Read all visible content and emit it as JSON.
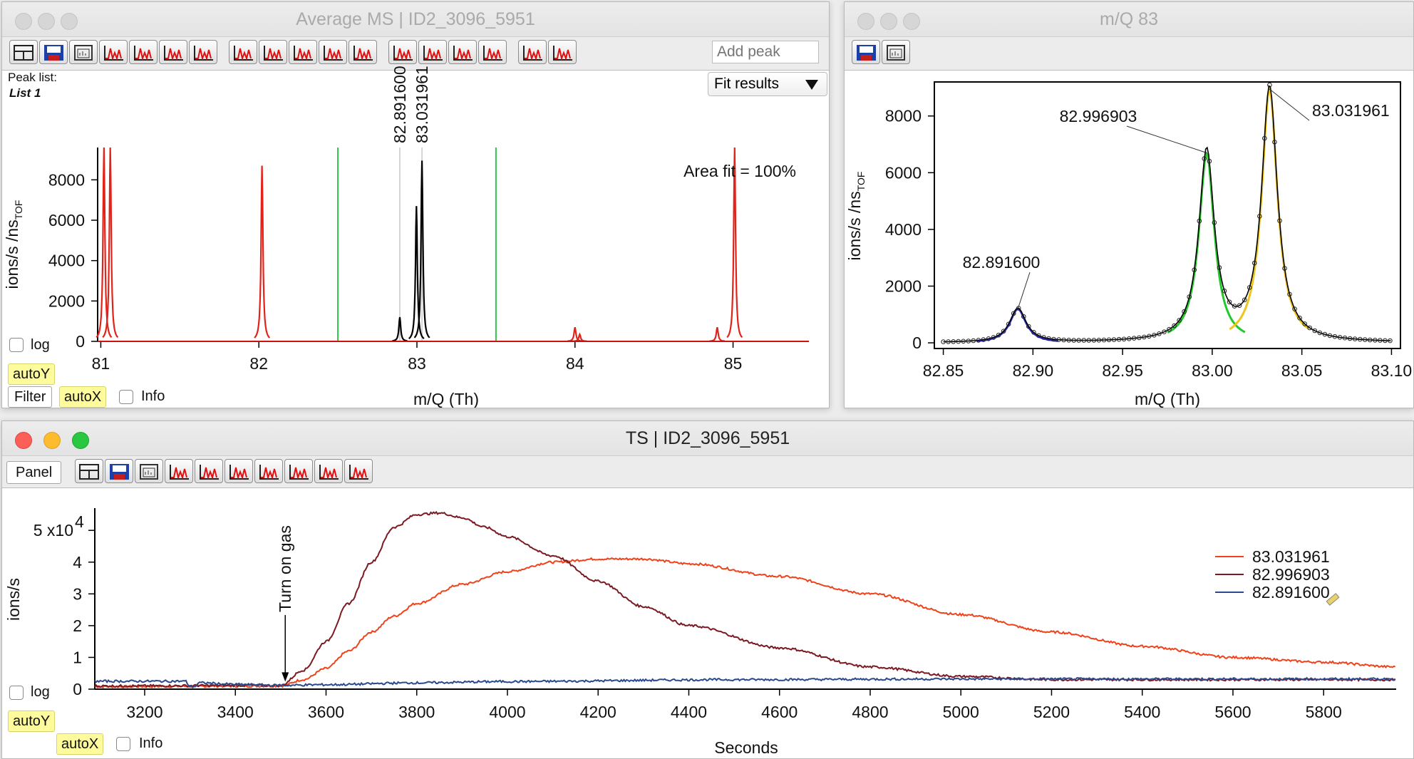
{
  "avg_window": {
    "title": "Average MS | ID2_3096_5951",
    "toolbar_icons": [
      "layout-icon",
      "save-icon",
      "graph-window-icon",
      "peak-fit-icon",
      "add-peak-icon",
      "mass-scale-icon",
      "text-axis-icon",
      "mass-calibration-icon",
      "peak-shape-icon",
      "resolution-icon",
      "isotope-icon",
      "peak-list-icon",
      "baseline-icon",
      "refresh-icon",
      "settings-icon",
      "delete-peak-icon",
      "md-plot-icon",
      "ts-icon"
    ],
    "add_peak_placeholder": "Add peak",
    "peak_list_label": "Peak list:",
    "peak_list_name": "List 1",
    "fit_results": "Fit results",
    "area_fit": "Area fit = 100%",
    "marker_labels": [
      "82.891600",
      "83.031961"
    ],
    "log": "log",
    "autoY": "autoY",
    "filter": "Filter",
    "autoX": "autoX",
    "info": "Info",
    "colors": {
      "spectrum": "#e2231a",
      "fit": "#000000",
      "window_line": "#2fc34d"
    }
  },
  "mq_window": {
    "title": "m/Q 83",
    "toolbar_icons": [
      "save-icon",
      "graph-window-icon"
    ]
  },
  "ts_window": {
    "title": "TS | ID2_3096_5951",
    "panel": "Panel",
    "toolbar_icons": [
      "layout-icon",
      "save-icon",
      "graph-window-icon",
      "peak-fit-icon",
      "add-peak-icon",
      "mass-scale-icon",
      "text-axis-icon",
      "peak-shape-icon",
      "resolution-icon",
      "peak-list-icon"
    ],
    "annotation": "Turn on gas",
    "log": "log",
    "autoY": "autoY",
    "autoX": "autoX",
    "info": "Info",
    "legend_position": "top-right"
  },
  "chart_data": [
    {
      "type": "line",
      "xlabel": "m/Q (Th)",
      "ylabel": "ions/s /ns",
      "ylabel_sub": "TOF",
      "xlim": [
        80.98,
        85.48
      ],
      "ylim": [
        0,
        9600
      ],
      "xticks": [
        "81",
        "82",
        "83",
        "84",
        "85"
      ],
      "yticks": [
        "0",
        "2000",
        "4000",
        "6000",
        "8000"
      ],
      "window_lines_x": [
        82.5,
        83.5
      ],
      "marker_lines_x": [
        82.8916,
        83.031961
      ],
      "peaks": [
        {
          "x": 81.02,
          "y": 9600,
          "series": "spectrum"
        },
        {
          "x": 81.06,
          "y": 9600,
          "series": "spectrum"
        },
        {
          "x": 82.02,
          "y": 8700,
          "series": "spectrum"
        },
        {
          "x": 82.8916,
          "y": 1200,
          "series": "fit"
        },
        {
          "x": 82.9969,
          "y": 6700,
          "series": "fit"
        },
        {
          "x": 83.031961,
          "y": 8950,
          "series": "fit"
        },
        {
          "x": 84.0,
          "y": 700,
          "series": "spectrum"
        },
        {
          "x": 84.03,
          "y": 350,
          "series": "spectrum"
        },
        {
          "x": 84.9,
          "y": 700,
          "series": "spectrum"
        },
        {
          "x": 85.01,
          "y": 9600,
          "series": "spectrum"
        }
      ]
    },
    {
      "type": "line",
      "xlabel": "m/Q (Th)",
      "ylabel": "ions/s /ns",
      "ylabel_sub": "TOF",
      "xlim": [
        82.845,
        83.105
      ],
      "ylim": [
        -200,
        9200
      ],
      "xticks": [
        "82.85",
        "82.90",
        "82.95",
        "83.00",
        "83.05",
        "83.10"
      ],
      "yticks": [
        "0",
        "2000",
        "4000",
        "6000",
        "8000"
      ],
      "peak_labels": [
        "82.996903",
        "83.031961",
        "82.891600"
      ],
      "peaks": [
        {
          "center": 82.8916,
          "height": 1200,
          "width": 0.0055,
          "color": "#2a2ad0"
        },
        {
          "center": 82.9969,
          "height": 6700,
          "width": 0.0052,
          "color": "#23c92a"
        },
        {
          "center": 83.031961,
          "height": 8950,
          "width": 0.0053,
          "color": "#f0c419"
        }
      ]
    },
    {
      "type": "line",
      "xlabel": "Seconds",
      "ylabel": "ions/s",
      "xlim": [
        3090,
        5960
      ],
      "ylim": [
        0,
        57000
      ],
      "xticks": [
        "3200",
        "3400",
        "3600",
        "3800",
        "4000",
        "4200",
        "4400",
        "4600",
        "4800",
        "5000",
        "5200",
        "5400",
        "5600",
        "5800"
      ],
      "yticks": [
        "0",
        "1",
        "2",
        "3",
        "4",
        "5 x10"
      ],
      "ytick_exp": "4",
      "annotation_x": 3510,
      "series": [
        {
          "name": "83.031961",
          "color": "#f0421a",
          "x": [
            3090,
            3500,
            3550,
            3600,
            3650,
            3700,
            3750,
            3800,
            3900,
            4000,
            4100,
            4200,
            4300,
            4400,
            4600,
            4800,
            5000,
            5200,
            5400,
            5600,
            5800,
            5960
          ],
          "y": [
            800,
            1000,
            3000,
            6500,
            12000,
            18000,
            23000,
            27000,
            33000,
            37000,
            40000,
            41000,
            41000,
            39500,
            35500,
            30000,
            23500,
            18000,
            13500,
            10000,
            8500,
            7000
          ]
        },
        {
          "name": "82.996903",
          "color": "#7c1a23",
          "x": [
            3090,
            3500,
            3550,
            3600,
            3650,
            3700,
            3750,
            3800,
            3850,
            3900,
            3950,
            4000,
            4100,
            4200,
            4300,
            4400,
            4600,
            4800,
            5000,
            5200,
            5400,
            5600,
            5800,
            5960
          ],
          "y": [
            1000,
            1200,
            6000,
            15000,
            27000,
            40000,
            51000,
            55000,
            55500,
            54000,
            51000,
            48000,
            42000,
            34000,
            26000,
            20000,
            13000,
            7000,
            4000,
            3000,
            3000,
            3000,
            3000,
            3000
          ]
        },
        {
          "name": "82.891600",
          "color": "#2a4a8e",
          "x": [
            3090,
            3290,
            3300,
            3310,
            3320,
            3400,
            3500,
            3600,
            3800,
            4000,
            4500,
            5000,
            5500,
            5960
          ],
          "y": [
            2500,
            2500,
            800,
            800,
            2000,
            1500,
            1200,
            1400,
            2000,
            2400,
            3000,
            3200,
            3200,
            3200
          ]
        }
      ]
    }
  ]
}
